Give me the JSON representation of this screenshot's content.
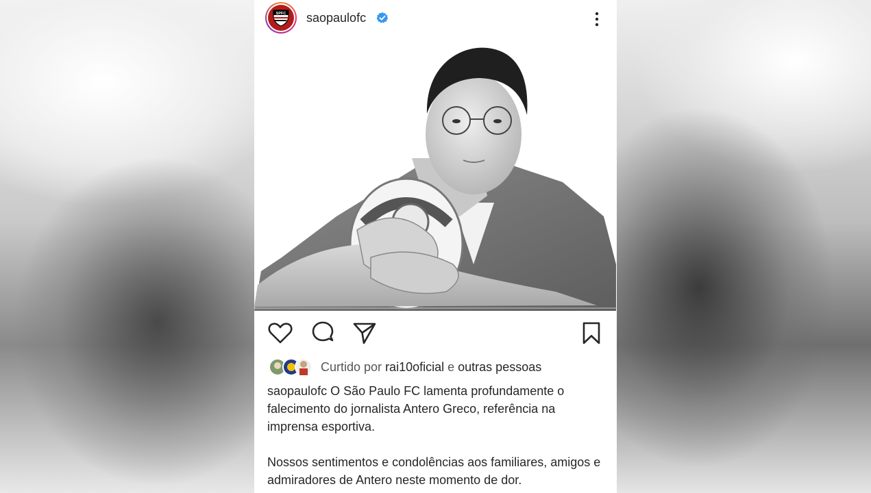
{
  "post": {
    "username": "saopaulofc",
    "avatar_logo_text": "SPFC",
    "icons": {
      "verified": "verified-badge-icon",
      "more": "more-options-icon",
      "like": "heart-icon",
      "comment": "comment-icon",
      "share": "send-icon",
      "save": "bookmark-icon"
    },
    "colors": {
      "verified_blue": "#3897f0",
      "club_red": "#b31b1b",
      "text": "#262626"
    },
    "liked_by": {
      "prefix": "Curtido por",
      "user": "rai10oficial",
      "conjunction": "e",
      "others": "outras pessoas"
    },
    "caption": {
      "username": "saopaulofc",
      "paragraph1": "O São Paulo FC lamenta profundamente o falecimento do jornalista Antero Greco, referência na imprensa esportiva.",
      "paragraph2": "Nossos sentimentos e condolências aos familiares, amigos e admiradores de Antero neste momento de dor."
    }
  }
}
